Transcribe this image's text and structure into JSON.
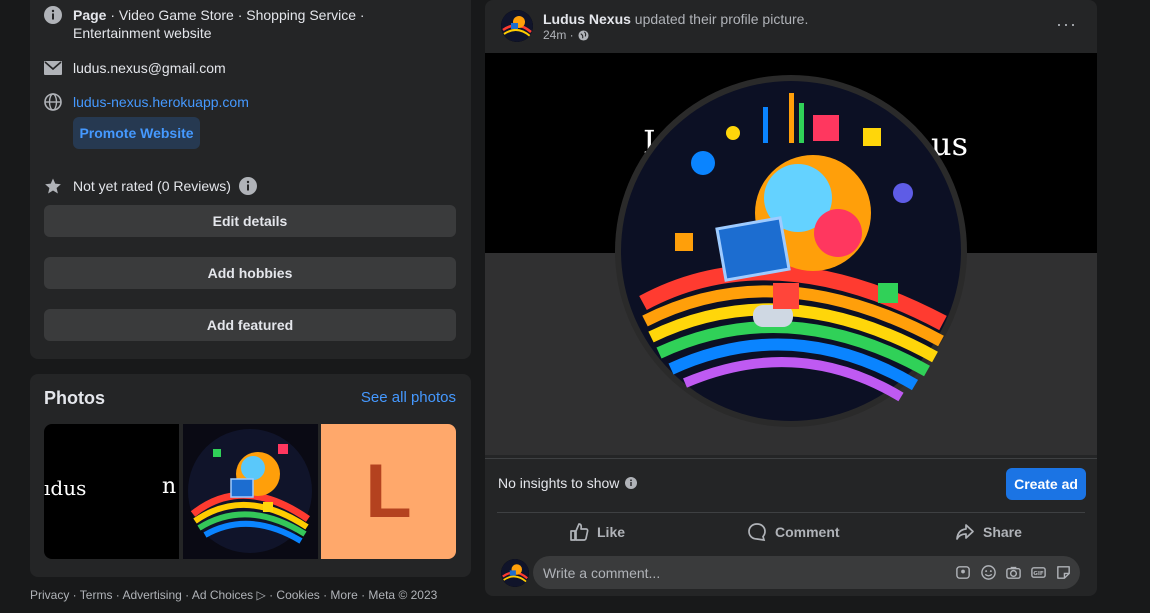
{
  "intro": {
    "category_prefix": "Page",
    "category_rest": " · Video Game Store · Shopping Service · Entertainment website",
    "email": "ludus.nexus@gmail.com",
    "website": "ludus-nexus.herokuapp.com",
    "promote_label": "Promote Website",
    "rating": "Not yet rated (0 Reviews)",
    "edit_details_label": "Edit details",
    "add_hobbies_label": "Add hobbies",
    "add_featured_label": "Add featured"
  },
  "photos": {
    "title": "Photos",
    "see_all_label": "See all photos",
    "thumb1_text_a": "ıdus",
    "thumb1_text_b": "n",
    "thumb3_letter": "L"
  },
  "footer": {
    "text": "Privacy · Terms · Advertising · Ad Choices ▷ · Cookies · More · Meta © 2023"
  },
  "post": {
    "author": "Ludus Nexus",
    "action": " updated their profile picture.",
    "time": "24m ·",
    "more": "···",
    "media_text_left": "L",
    "media_text_right": "us",
    "insights_text": "No insights to show",
    "create_ad_label": "Create ad",
    "like_label": "Like",
    "comment_label": "Comment",
    "share_label": "Share",
    "comment_placeholder": "Write a comment..."
  },
  "colors": {
    "background": "#18191a",
    "card": "#242526",
    "accent": "#4599ff",
    "primary_button": "#1b74e4",
    "thumb3_bg": "#ffa86b",
    "thumb3_letter": "#b4421f"
  }
}
